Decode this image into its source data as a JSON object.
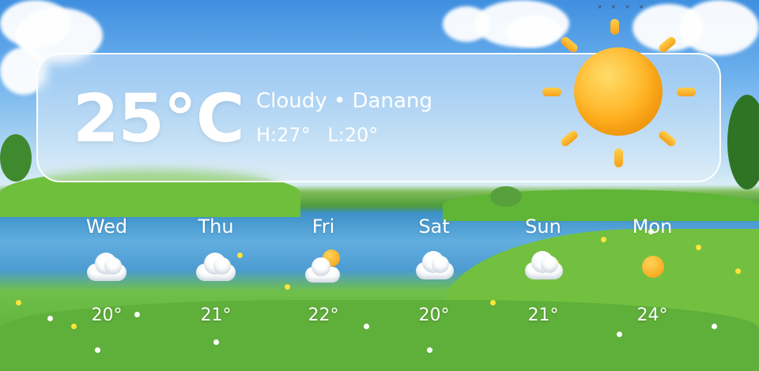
{
  "current": {
    "temperature": "25°C",
    "condition": "Cloudy • Danang",
    "high": "H:27°",
    "low": "L:20°",
    "icon": "sun-icon"
  },
  "forecast": [
    {
      "day": "Wed",
      "temp": "20°",
      "icon": "cloud-icon"
    },
    {
      "day": "Thu",
      "temp": "21°",
      "icon": "cloud-icon"
    },
    {
      "day": "Fri",
      "temp": "22°",
      "icon": "partly-sunny-icon"
    },
    {
      "day": "Sat",
      "temp": "20°",
      "icon": "rain-cloud-icon"
    },
    {
      "day": "Sun",
      "temp": "21°",
      "icon": "rain-cloud-icon"
    },
    {
      "day": "Mon",
      "temp": "24°",
      "icon": "sun-icon"
    }
  ],
  "colors": {
    "text": "#ffffff",
    "sun": "#ffb11f",
    "panel_border": "#ffffff"
  }
}
